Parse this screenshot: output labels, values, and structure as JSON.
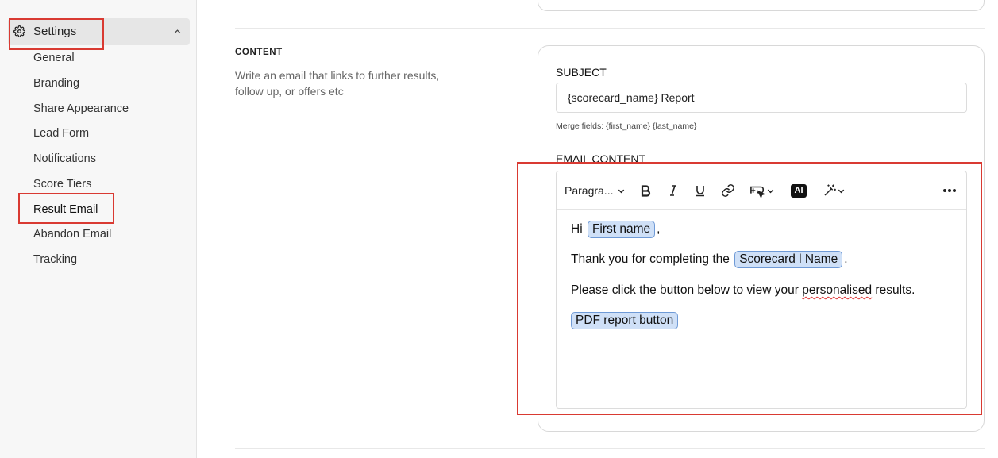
{
  "sidebar": {
    "settings_label": "Settings",
    "items": [
      "General",
      "Branding",
      "Share Appearance",
      "Lead Form",
      "Notifications",
      "Score Tiers",
      "Result Email",
      "Abandon Email",
      "Tracking"
    ],
    "active_item": "Result Email"
  },
  "section": {
    "label": "CONTENT",
    "description": "Write an email that links to further results, follow up, or offers etc"
  },
  "subject": {
    "label": "SUBJECT",
    "value": "{scorecard_name} Report",
    "merge_hint": "Merge fields: {first_name} {last_name}"
  },
  "email_content": {
    "label": "EMAIL CONTENT",
    "toolbar": {
      "paragraph_label": "Paragra...",
      "ai_label": "AI"
    },
    "body": {
      "line1_prefix": "Hi ",
      "line1_chip": "First name",
      "line1_suffix": ",",
      "line2_prefix": "Thank you for completing the ",
      "line2_chip": "Scorecard l Name",
      "line2_suffix": ".",
      "line3_a": "Please click the button below to view your ",
      "line3_spell": "personalised",
      "line3_b": " results.",
      "line4_chip": "PDF report button"
    }
  },
  "colors": {
    "highlight": "#d93a32",
    "chip_bg": "#cfe0f7",
    "chip_border": "#6f9ad6"
  }
}
